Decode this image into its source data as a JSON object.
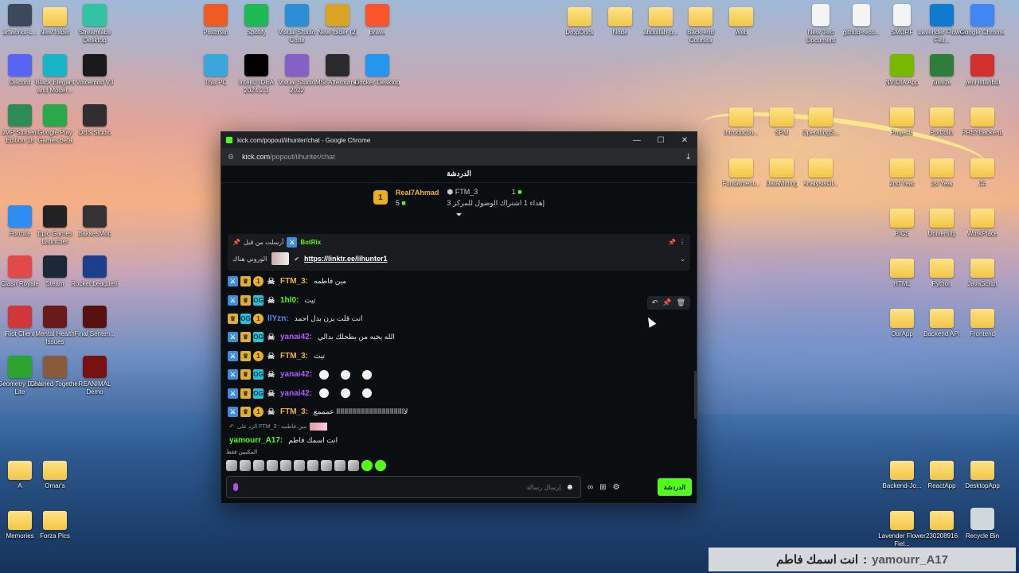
{
  "desktop": {
    "icons": [
      {
        "label": "artworks-L...",
        "kind": "app",
        "color": "#3a4a5a"
      },
      {
        "label": "New folder",
        "kind": "folder",
        "color": "#f3c542"
      },
      {
        "label": "Streamlabs Desktop",
        "kind": "app",
        "color": "#31c3a2"
      },
      {
        "label": "Discord",
        "kind": "app",
        "color": "#5865f2"
      },
      {
        "label": "Black Elegant and Moder...",
        "kind": "app",
        "color": "#18b5c8"
      },
      {
        "label": "Voicemod V3",
        "kind": "app",
        "color": "#1a1a1a"
      },
      {
        "label": "JMP Student Edition 18",
        "kind": "app",
        "color": "#2e8b57"
      },
      {
        "label": "Google Play Games beta",
        "kind": "app",
        "color": "#2aa84a"
      },
      {
        "label": "OBS Studio",
        "kind": "app",
        "color": "#302e31"
      },
      {
        "label": "Fortnite",
        "kind": "app",
        "color": "#2f8cf0"
      },
      {
        "label": "Epic Games Launcher",
        "kind": "app",
        "color": "#222"
      },
      {
        "label": "BakkesMod",
        "kind": "app",
        "color": "#333"
      },
      {
        "label": "Clash Royale",
        "kind": "app",
        "color": "#e24a4a"
      },
      {
        "label": "Steam",
        "kind": "app",
        "color": "#1b2838"
      },
      {
        "label": "Rocket League®",
        "kind": "app",
        "color": "#1c3f8c"
      },
      {
        "label": "Riot Client",
        "kind": "app",
        "color": "#d13639"
      },
      {
        "label": "Mental Health Issues",
        "kind": "app",
        "color": "#6b1a1a"
      },
      {
        "label": "Final Senten...",
        "kind": "app",
        "color": "#5a1010"
      },
      {
        "label": "Geometry Dash Lite",
        "kind": "app",
        "color": "#2ba52b"
      },
      {
        "label": "Chained Together",
        "kind": "app",
        "color": "#8a5a3a"
      },
      {
        "label": "REANIMAL Demo",
        "kind": "app",
        "color": "#7a1010"
      },
      {
        "label": "A",
        "kind": "folder",
        "color": "#f3c542"
      },
      {
        "label": "Omar's",
        "kind": "folder",
        "color": "#f3c542"
      },
      {
        "label": "Memories",
        "kind": "folder",
        "color": "#f3c542"
      },
      {
        "label": "Forza Pics",
        "kind": "folder",
        "color": "#f3c542"
      },
      {
        "label": "Postman",
        "kind": "app",
        "color": "#ef5b25"
      },
      {
        "label": "Spotify",
        "kind": "app",
        "color": "#1db954"
      },
      {
        "label": "Visual Studio Code",
        "kind": "app",
        "color": "#2c8fd6"
      },
      {
        "label": "New folder (2)",
        "kind": "app",
        "color": "#d9a324"
      },
      {
        "label": "Brave",
        "kind": "app",
        "color": "#fb542b"
      },
      {
        "label": "This PC",
        "kind": "app",
        "color": "#3aa7d8"
      },
      {
        "label": "IntelliJ IDEA 2024.2.1",
        "kind": "app",
        "color": "#000"
      },
      {
        "label": "Visual Studio 2022",
        "kind": "app",
        "color": "#8661c5"
      },
      {
        "label": "MSI Afterburner",
        "kind": "app",
        "color": "#2a2a2a"
      },
      {
        "label": "Docker Desktop",
        "kind": "app",
        "color": "#2496ed"
      },
      {
        "label": "DropDocs",
        "kind": "folder",
        "color": "#f3c542"
      },
      {
        "label": "Node",
        "kind": "folder",
        "color": "#f3c542"
      },
      {
        "label": "abdullah-p...",
        "kind": "folder",
        "color": "#f3c542"
      },
      {
        "label": "Back-end Coursra",
        "kind": "folder",
        "color": "#f3c542"
      },
      {
        "label": "Web",
        "kind": "folder",
        "color": "#f3c542"
      },
      {
        "label": "New Text Document",
        "kind": "doc",
        "color": "#f4f4f4"
      },
      {
        "label": "github-reco...",
        "kind": "doc",
        "color": "#f4f4f4"
      },
      {
        "label": "SMURF",
        "kind": "doc",
        "color": "#f4f4f4"
      },
      {
        "label": "Lavender Flower Fiel...",
        "kind": "app",
        "color": "#0f7bd0"
      },
      {
        "label": "Google Chrome",
        "kind": "app",
        "color": "#4285f4"
      },
      {
        "label": "NVIDIA App",
        "kind": "app",
        "color": "#76b900"
      },
      {
        "label": "fullsize",
        "kind": "app",
        "color": "#2f7d3a"
      },
      {
        "label": "yeni istanbul",
        "kind": "app",
        "color": "#d32f2f"
      },
      {
        "label": "Introductio...",
        "kind": "folder",
        "color": "#f3c542"
      },
      {
        "label": "SPM",
        "kind": "folder",
        "color": "#f3c542"
      },
      {
        "label": "OperatingS...",
        "kind": "folder",
        "color": "#f3c542"
      },
      {
        "label": "Projects",
        "kind": "folder",
        "color": "#f3c542"
      },
      {
        "label": "Portfolio",
        "kind": "folder",
        "color": "#f3c542"
      },
      {
        "label": "PREYbackend",
        "kind": "folder",
        "color": "#f3c542"
      },
      {
        "label": "Fundament...",
        "kind": "folder",
        "color": "#f3c542"
      },
      {
        "label": "DataMining",
        "kind": "folder",
        "color": "#f3c542"
      },
      {
        "label": "AnalysisOf...",
        "kind": "folder",
        "color": "#f3c542"
      },
      {
        "label": "2nd Year",
        "kind": "folder",
        "color": "#f3c542"
      },
      {
        "label": "1st Year",
        "kind": "folder",
        "color": "#f3c542"
      },
      {
        "label": "C#",
        "kind": "folder",
        "color": "#f3c542"
      },
      {
        "label": "PICS",
        "kind": "folder",
        "color": "#f3c542"
      },
      {
        "label": "University",
        "kind": "folder",
        "color": "#f3c542"
      },
      {
        "label": "WorkPlace",
        "kind": "folder",
        "color": "#f3c542"
      },
      {
        "label": "HTML",
        "kind": "folder",
        "color": "#f3c542"
      },
      {
        "label": "Python",
        "kind": "folder",
        "color": "#f3c542"
      },
      {
        "label": "JavaScript",
        "kind": "folder",
        "color": "#f3c542"
      },
      {
        "label": "OurApp",
        "kind": "folder",
        "color": "#f3c542"
      },
      {
        "label": "Backend API",
        "kind": "folder",
        "color": "#f3c542"
      },
      {
        "label": "Frontend",
        "kind": "folder",
        "color": "#f3c542"
      },
      {
        "label": "Backend-Jo...",
        "kind": "folder",
        "color": "#f3c542"
      },
      {
        "label": "ReactApp",
        "kind": "folder",
        "color": "#f3c542"
      },
      {
        "label": "DesktopApp",
        "kind": "folder",
        "color": "#f3c542"
      },
      {
        "label": "Lavender Flower Fiel...",
        "kind": "folder",
        "color": "#f3c542"
      },
      {
        "label": "230208916",
        "kind": "folder",
        "color": "#f3c542"
      },
      {
        "label": "Recycle Bin",
        "kind": "app",
        "color": "#cfd8dc"
      }
    ]
  },
  "window": {
    "title": "kick.com/popout/iihunter/chat - Google Chrome",
    "controls": {
      "minimize": "—",
      "maximize": "☐",
      "close": "✕"
    },
    "url_domain": "kick.com",
    "url_path": "/popout/iihunter/chat"
  },
  "chat": {
    "header": "الدردشة",
    "leaderboard": {
      "rank_badge": "1",
      "first_name": "Real7Ahmad",
      "first_count": "5",
      "second_name": "FTM_3",
      "second_count": "1",
      "sub_text": "إهداء 1 اشتراك الوصول للمركز 3"
    },
    "pinned": {
      "sent_by": "أرسلت من قبل",
      "bot_name": "BotRix",
      "message_prefix": "الوروني هناك",
      "link": "https://linktr.ee/iihunter1"
    },
    "messages": [
      {
        "user": "FTM_3",
        "color": "u-gold",
        "text": "مين فاطمه",
        "badges": [
          "sword",
          "crown",
          "one",
          "skull"
        ]
      },
      {
        "user": "1hl0",
        "color": "u-green",
        "text": "تيت",
        "badges": [
          "sword",
          "crown",
          "og",
          "skull"
        ]
      },
      {
        "user": "llYzn",
        "color": "u-blue",
        "text": "انت قلت يزن بدل احمد",
        "badges": [
          "crown",
          "og",
          "one"
        ]
      },
      {
        "user": "yanai42",
        "color": "u-purple",
        "text": "الله يخيه من يطحلك بدالي",
        "badges": [
          "sword",
          "crown",
          "og",
          "skull"
        ]
      },
      {
        "user": "FTM_3",
        "color": "u-gold",
        "text": "تيت",
        "badges": [
          "sword",
          "crown",
          "one",
          "skull"
        ]
      },
      {
        "user": "yanai42",
        "color": "u-purple",
        "text": "",
        "badges": [
          "sword",
          "crown",
          "og",
          "skull"
        ],
        "emotes": 3
      },
      {
        "user": "yanai42",
        "color": "u-purple",
        "text": "",
        "badges": [
          "sword",
          "crown",
          "og",
          "skull"
        ],
        "emotes": 3
      },
      {
        "user": "FTM_3",
        "color": "u-gold",
        "text": "لااااااااااااااااااااااااااااااااااا عمممع",
        "badges": [
          "sword",
          "crown",
          "one",
          "skull"
        ]
      }
    ],
    "reply": {
      "line": "الرد على FTM_3 : مين فاطمه",
      "user": "yamourr_A17",
      "text": "انت اسمك فاطم"
    },
    "emote_label": "المكتبين فقط",
    "input_placeholder": "إرسال رسالة",
    "send_label": "الدردشة"
  },
  "caption": {
    "text": "انت اسمك فاطم",
    "separator": ":",
    "user": "yamourr_A17"
  }
}
